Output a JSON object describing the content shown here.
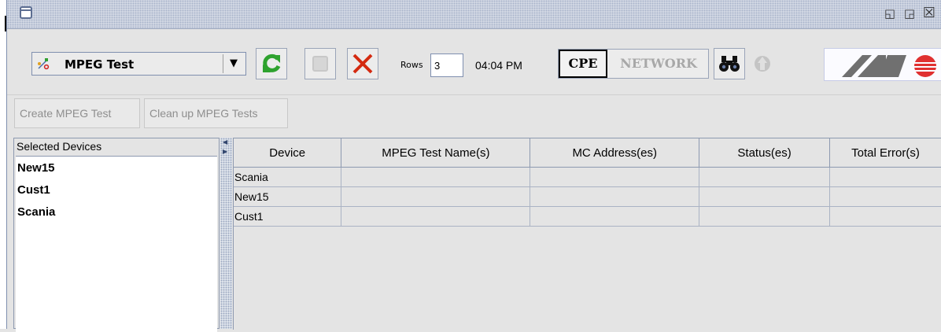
{
  "window": {
    "title": "",
    "controls": [
      {
        "name": "restore-icon",
        "glyph": "◱"
      },
      {
        "name": "maximize-icon",
        "glyph": "◲"
      },
      {
        "name": "close-icon",
        "glyph": "☒"
      }
    ]
  },
  "toolbar": {
    "test_selector": {
      "value": "MPEG Test",
      "icon": "network-test-icon"
    },
    "rows_label": "Rows",
    "rows_value": "3",
    "time": "04:04 PM",
    "view_toggle": {
      "cpe": "CPE",
      "network": "NETWORK",
      "selected": "CPE"
    }
  },
  "actions": {
    "create": "Create MPEG Test",
    "cleanup": "Clean up MPEG Tests"
  },
  "left_panel": {
    "header": "Selected Devices",
    "devices": [
      "New15",
      "Cust1",
      "Scania"
    ]
  },
  "table": {
    "columns": [
      "Device",
      "MPEG Test Name(s)",
      "MC Address(es)",
      "Status(es)",
      "Total Error(s)"
    ],
    "rows": [
      [
        "Scania",
        "",
        "",
        "",
        ""
      ],
      [
        "New15",
        "",
        "",
        "",
        ""
      ],
      [
        "Cust1",
        "",
        "",
        "",
        ""
      ]
    ]
  },
  "colors": {
    "refresh": "#2ea22e",
    "cancel": "#d42a10",
    "logo_red": "#e03030",
    "logo_gray": "#707070"
  }
}
